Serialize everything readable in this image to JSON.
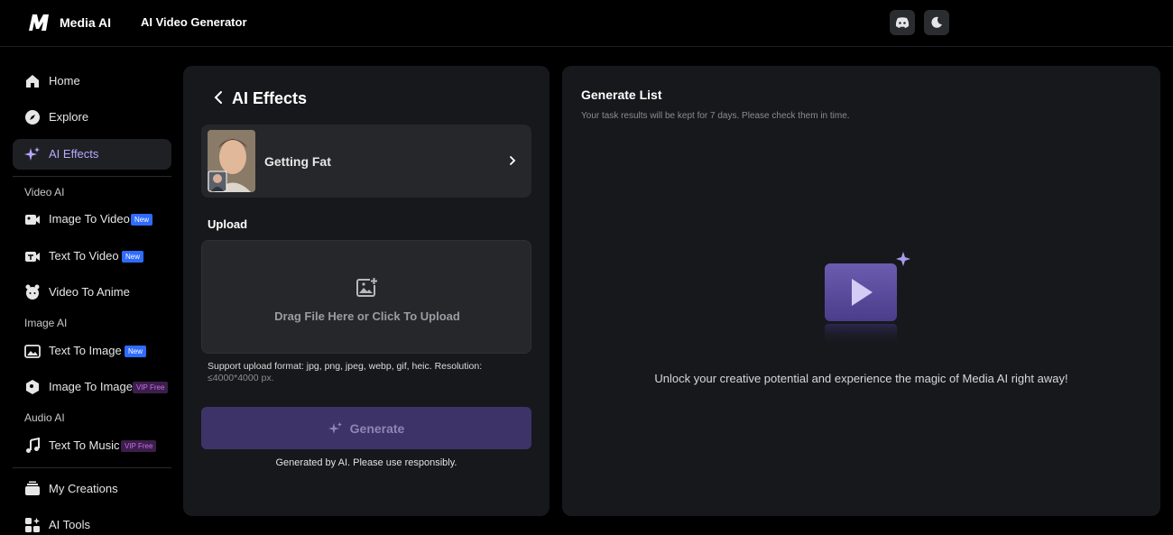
{
  "header": {
    "brand": "Media AI",
    "app_title": "AI Video Generator",
    "discord_icon": "discord-icon",
    "theme_icon": "moon-icon"
  },
  "sidebar": {
    "home": "Home",
    "explore": "Explore",
    "ai_effects": "AI Effects",
    "video_ai_title": "Video AI",
    "image_to_video": "Image To Video",
    "text_to_video": "Text To Video",
    "video_to_anime": "Video To Anime",
    "image_ai_title": "Image AI",
    "text_to_image": "Text To Image",
    "image_to_image": "Image To Image",
    "audio_ai_title": "Audio AI",
    "text_to_music": "Text To Music",
    "my_creations": "My Creations",
    "ai_tools": "AI Tools",
    "badge_new": "New",
    "badge_vip": "VIP Free"
  },
  "main": {
    "title": "AI Effects",
    "effect_name": "Getting Fat",
    "upload_label": "Upload",
    "upload_prompt": "Drag File Here or Click To Upload",
    "support_line1": "Support upload format: jpg, png, jpeg, webp, gif, heic. Resolution:",
    "support_line2": "≤4000*4000 px.",
    "generate_label": "Generate",
    "disclaimer": "Generated by AI. Please use responsibly."
  },
  "generate_list": {
    "title": "Generate List",
    "subtitle": "Your task results will be kept for 7 days. Please check them in time.",
    "empty_message": "Unlock your creative potential and experience the magic of Media AI right away!"
  },
  "colors": {
    "accent": "#b9a8ff",
    "generate_button": "#3d3369",
    "badge_new": "#2f6bff",
    "badge_vip": "#c86cf0"
  }
}
